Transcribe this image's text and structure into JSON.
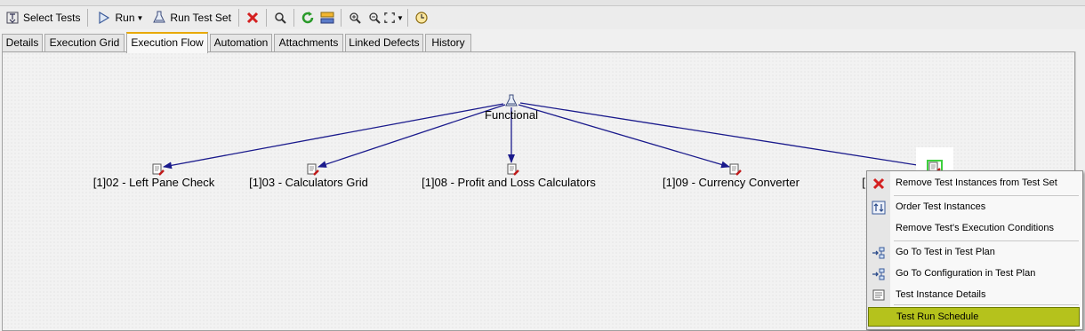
{
  "toolbar": {
    "select_tests": "Select Tests",
    "run": "Run",
    "run_test_set": "Run Test Set",
    "icons": [
      "select-tests-icon",
      "run-icon",
      "run-test-set-icon",
      "delete-icon",
      "find-icon",
      "refresh-icon",
      "filter-icon",
      "zoom-in-icon",
      "zoom-out-icon",
      "fit-to-window-icon",
      "schedule-icon"
    ]
  },
  "tabs": [
    {
      "label": "Details"
    },
    {
      "label": "Execution Grid"
    },
    {
      "label": "Execution Flow"
    },
    {
      "label": "Automation"
    },
    {
      "label": "Attachments"
    },
    {
      "label": "Linked Defects"
    },
    {
      "label": "History"
    }
  ],
  "active_tab": "Execution Flow",
  "flow": {
    "root": "Functional",
    "nodes": [
      {
        "label": "[1]02 - Left Pane Check"
      },
      {
        "label": "[1]03 - Calculators Grid"
      },
      {
        "label": "[1]08 - Profit and Loss Calculators"
      },
      {
        "label": "[1]09 - Currency Converter"
      },
      {
        "label": "["
      }
    ]
  },
  "context_menu": {
    "items": [
      {
        "label": "Remove Test Instances from Test Set",
        "icon": "remove-icon"
      },
      {
        "label": "Order Test Instances",
        "icon": "order-icon"
      },
      {
        "label": "Remove Test's Execution Conditions",
        "icon": ""
      },
      {
        "label": "Go To Test in Test Plan",
        "icon": "go-to-test-icon"
      },
      {
        "label": "Go To Configuration in Test Plan",
        "icon": "go-to-configuration-icon"
      },
      {
        "label": "Test Instance Details",
        "icon": "details-icon"
      },
      {
        "label": "Test Run Schedule",
        "icon": ""
      }
    ],
    "highlighted": "Test Run Schedule"
  },
  "colors": {
    "edge": "#1a1a8c",
    "active_tab_accent": "#e8a900",
    "menu_highlight": "#b5c21c"
  }
}
